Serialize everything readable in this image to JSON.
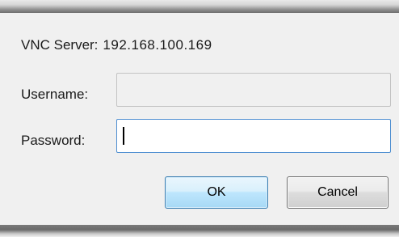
{
  "dialog": {
    "server_label": "VNC Server:",
    "server_address": "192.168.100.169",
    "username_label": "Username:",
    "username_value": "",
    "password_label": "Password:",
    "password_value": "",
    "ok_label": "OK",
    "cancel_label": "Cancel"
  },
  "colors": {
    "dialog_background": "#f0f0f0",
    "focused_field_border": "#4f8fd1",
    "default_button_border": "#3c7fb1"
  }
}
